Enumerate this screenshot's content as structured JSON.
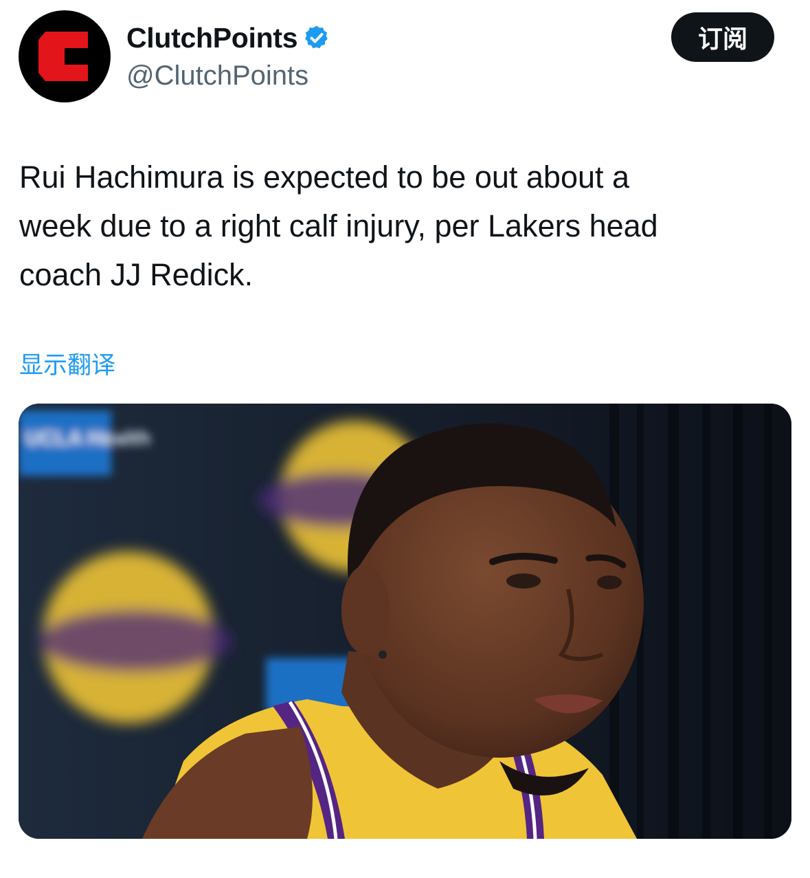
{
  "author": {
    "display_name": "ClutchPoints",
    "handle": "@ClutchPoints",
    "verified": true,
    "avatar_icon": "clutchpoints-c-logo-icon",
    "verified_icon": "verified-badge-icon"
  },
  "subscribe_label": "订阅",
  "tweet": {
    "text": "Rui Hachimura is expected to be out about a\nweek due to a right calf injury, per Lakers head\ncoach JJ Redick.",
    "translate_label": "显示翻译"
  },
  "media": {
    "backdrop_text": "UCLA Health"
  },
  "colors": {
    "accent": "#1d9bf0",
    "text": "#0f1419",
    "secondary_text": "#536471",
    "logo_red": "#e4141b",
    "lakers_gold": "#f6c72e",
    "lakers_purple": "#552583"
  }
}
